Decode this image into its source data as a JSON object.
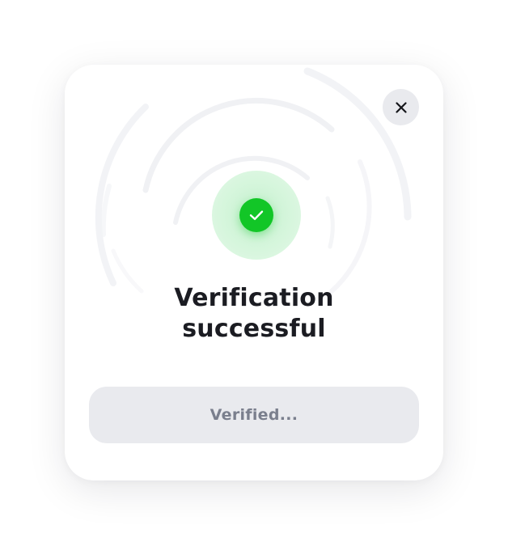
{
  "dialog": {
    "title_line1": "Verification",
    "title_line2": "successful",
    "button_label": "Verified..."
  },
  "icons": {
    "close": "close-icon",
    "success": "checkmark-icon"
  },
  "colors": {
    "success": "#12c627",
    "success_halo": "#d3f5da",
    "button_bg": "#e9eaee",
    "button_text": "#7a7f8d",
    "title_text": "#1b1c22"
  }
}
